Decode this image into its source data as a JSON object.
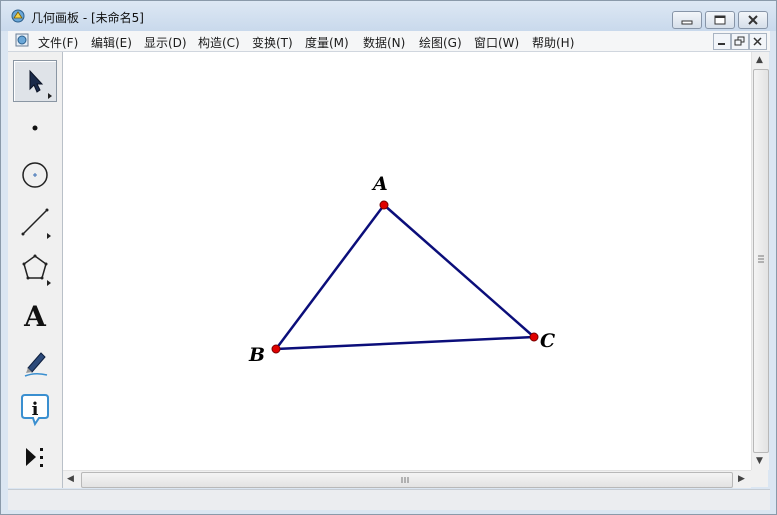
{
  "window": {
    "title": "几何画板 - [未命名5]"
  },
  "menu": {
    "items": [
      "文件(F)",
      "编辑(E)",
      "显示(D)",
      "构造(C)",
      "变换(T)",
      "度量(M)",
      "数据(N)",
      "绘图(G)",
      "窗口(W)",
      "帮助(H)"
    ]
  },
  "toolbox": {
    "tools": [
      {
        "name": "selection-arrow-icon",
        "active": true
      },
      {
        "name": "point-icon",
        "active": false
      },
      {
        "name": "compass-icon",
        "active": false
      },
      {
        "name": "straightedge-icon",
        "active": false
      },
      {
        "name": "polygon-icon",
        "active": false
      },
      {
        "name": "text-tool-icon",
        "label": "A",
        "active": false
      },
      {
        "name": "marker-pen-icon",
        "active": false
      },
      {
        "name": "information-icon",
        "active": false
      },
      {
        "name": "custom-tools-icon",
        "active": false
      }
    ]
  },
  "sketch": {
    "points": [
      {
        "label": "A"
      },
      {
        "label": "B"
      },
      {
        "label": "C"
      }
    ],
    "segments": [
      "AB",
      "BC",
      "CA"
    ],
    "segment_color": "#0b0e7a",
    "point_color": "#e00000"
  },
  "colors": {
    "titlebar": "#c9d9ec",
    "canvas": "#ffffff"
  }
}
